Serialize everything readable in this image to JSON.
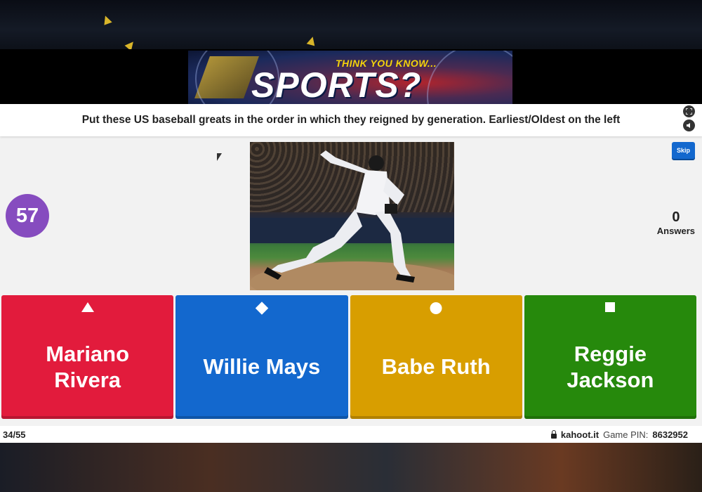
{
  "banner": {
    "kicker": "THINK YOU KNOW...",
    "headline": "SPORTS?"
  },
  "question": {
    "text": "Put these US baseball greats in the order in which they reigned by generation. Earliest/Oldest on the left"
  },
  "controls": {
    "fullscreen_icon": "fullscreen-icon",
    "sound_icon": "sound-icon",
    "skip_label": "Skip"
  },
  "timer": {
    "seconds": "57"
  },
  "answers_count": {
    "value": "0",
    "label": "Answers"
  },
  "image": {
    "subject": "baseball-pitcher-photo"
  },
  "tiles": [
    {
      "label": "Mariano Rivera",
      "shape": "triangle-icon",
      "color": "#e21b3c"
    },
    {
      "label": "Willie Mays",
      "shape": "diamond-icon",
      "color": "#1368ce"
    },
    {
      "label": "Babe Ruth",
      "shape": "circle-icon",
      "color": "#d89e00"
    },
    {
      "label": "Reggie Jackson",
      "shape": "square-icon",
      "color": "#26890c"
    }
  ],
  "footer": {
    "progress": "34/55",
    "site": "kahoot.it",
    "pin_label": "Game PIN:",
    "pin": "8632952"
  },
  "colors": {
    "accent_purple": "#864cbf",
    "skip_blue": "#1368ce"
  }
}
